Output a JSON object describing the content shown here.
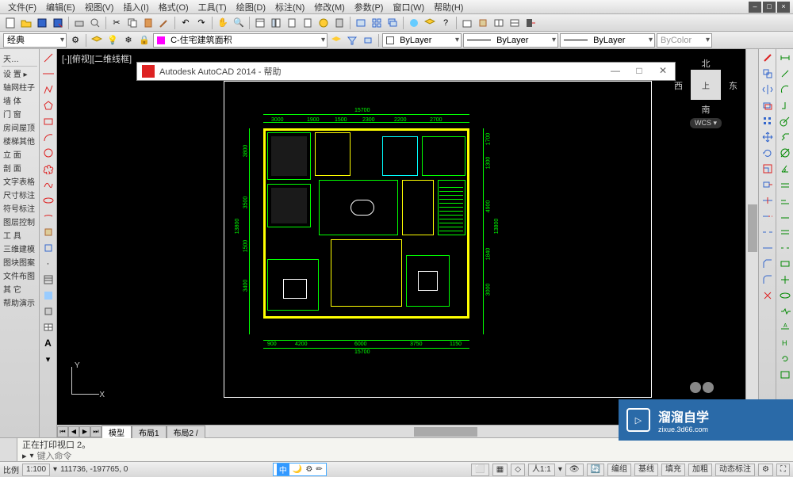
{
  "menubar": {
    "items": [
      "文件(F)",
      "编辑(E)",
      "视图(V)",
      "插入(I)",
      "格式(O)",
      "工具(T)",
      "绘图(D)",
      "标注(N)",
      "修改(M)",
      "参数(P)",
      "窗口(W)",
      "帮助(H)"
    ]
  },
  "properties_toolbar": {
    "workspace": "经典",
    "layer": "C-住宅建筑面积",
    "color": "ByLayer",
    "linetype": "ByLayer",
    "lineweight": "ByLayer",
    "plotstyle": "ByColor"
  },
  "sidebar": {
    "title": "天…",
    "items": [
      "设 置",
      "轴网柱子",
      "墙 体",
      "门 窗",
      "房间屋顶",
      "楼梯其他",
      "立 面",
      "剖 面",
      "文字表格",
      "尺寸标注",
      "符号标注",
      "图层控制",
      "工 具",
      "三维建模",
      "图块图案",
      "文件布图",
      "其 它",
      "帮助演示"
    ]
  },
  "canvas": {
    "viewport_label": "[-][俯视][二维线框]"
  },
  "help_dialog": {
    "title": "Autodesk AutoCAD 2014 - 帮助"
  },
  "viewcube": {
    "n": "北",
    "s": "南",
    "e": "东",
    "w": "西",
    "top": "上",
    "wcs": "WCS ▾"
  },
  "ucs": {
    "x": "X",
    "y": "Y"
  },
  "layout_tabs": {
    "tabs": [
      "模型",
      "布局1",
      "布局2"
    ],
    "active": 0
  },
  "dimensions": {
    "total_w": "15700",
    "total_h": "13800",
    "top": [
      "3000",
      "1900",
      "1500",
      "2300",
      "2200",
      "2700"
    ],
    "left": [
      "3800",
      "3500",
      "1500",
      "3400"
    ],
    "right": [
      "1700",
      "1300",
      "4900",
      "1840",
      "3000"
    ],
    "bottom": [
      "900",
      "4200",
      "6000",
      "3750",
      "1150"
    ]
  },
  "command": {
    "history": "正在打印视口 2。",
    "prompt_icon": "▸",
    "placeholder": "键入命令"
  },
  "statusbar": {
    "scale_label": "比例",
    "scale": "1:100",
    "coords": "111736, -197765, 0",
    "ime": "中",
    "anno_scale": "人1:1",
    "toggles": [
      "编组",
      "基线",
      "填充",
      "加粗",
      "动态标注"
    ]
  },
  "watermark": {
    "brand": "溜溜自学",
    "url": "zixue.3d66.com"
  }
}
